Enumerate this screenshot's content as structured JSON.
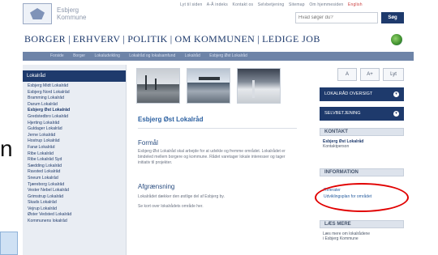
{
  "header": {
    "logo_text": "Esbjerg Kommune",
    "util_links": [
      "Lyt til siden",
      "A-Å indeks",
      "Kontakt os",
      "Selvbetjening",
      "Sitemap",
      "Om hjemmesiden"
    ],
    "util_links_highlight": "English",
    "search": {
      "value": "Hvad søger du?",
      "button": "Søg"
    }
  },
  "mainnav": {
    "items": [
      "BORGER",
      "ERHVERV",
      "POLITIK",
      "OM KOMMUNEN",
      "LEDIGE JOB"
    ]
  },
  "breadcrumb": [
    "Forside",
    "Borger",
    "Lokaludvikling",
    "Lokalråd og lokalsamfund",
    "Lokalråd",
    "Esbjerg Øst Lokalråd"
  ],
  "sidebar": {
    "heading": "Lokalråd",
    "items": [
      "Esbjerg Midt Lokalråd",
      "Esbjerg Nord Lokalråd",
      "Bramming Lokalråd",
      "Darum Lokalråd",
      "Esbjerg Øst Lokalråd",
      "Gredstedbro Lokalråd",
      "Hjerting Lokalråd",
      "Guldager Lokalråd",
      "Jerne Lokalråd",
      "Hostrup Lokalråd",
      "Fanø Lokalråd",
      "Ribe Lokalråd",
      "Ribe Lokalråd Syd",
      "Sædding Lokalråd",
      "Ravsted Lokalråd",
      "Sneum Lokalråd",
      "Tjæreborg Lokalråd",
      "Vester Nebel Lokalråd",
      "Grimstrup Lokalråd",
      "Skads Lokalråd",
      "Vejrup Lokalråd",
      "Øster Vedsted Lokalråd",
      "Kommunens lokalråd"
    ],
    "active_index": 4
  },
  "content": {
    "title": "Esbjerg Øst Lokalråd",
    "formal_heading": "Formål",
    "formal_body": "Esbjerg Øst Lokalråd skal arbejde for at udvikle og fremme området. Lokalrådet er bindeled mellem borgere og kommune. Rådet varetager lokale interesser og tager initiativ til projekter.",
    "afgr_heading": "Afgrænsning",
    "afgr_items": [
      "Lokalrådet dækker den østlige del af Esbjerg by.",
      "Se kort over lokalrådets område her."
    ]
  },
  "right": {
    "font_buttons": [
      "A",
      "A+",
      "Lyt"
    ],
    "dark_buttons": [
      "LOKALRÅD OVERSIGT",
      "SELVBETJENING"
    ],
    "contact_head": "KONTAKT",
    "contact_name": "Esbjerg Øst Lokalråd",
    "contact_line": "Kontaktperson",
    "info_head": "INFORMATION",
    "info_links": [
      "Referater",
      "Udviklingsplan for området"
    ],
    "read_more_head": "LÆS MERE",
    "read_more_lines": [
      "Læs mere om lokalrådene",
      "i Esbjerg Kommune"
    ]
  },
  "overlay": {
    "partial_glyph": "n"
  },
  "colors": {
    "brand_blue": "#1e3a6c",
    "link_blue": "#2a5fa0",
    "highlight_red": "#e10000"
  }
}
